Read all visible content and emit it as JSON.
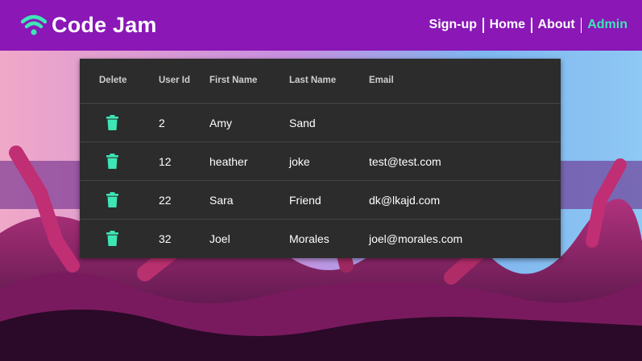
{
  "brand": {
    "name": "Code Jam",
    "icon": "wifi-icon",
    "icon_color": "#3ee6b6"
  },
  "nav": {
    "items": [
      {
        "label": "Sign-up",
        "active": false
      },
      {
        "label": "Home",
        "active": false
      },
      {
        "label": "About",
        "active": false
      },
      {
        "label": "Admin",
        "active": true
      }
    ],
    "bar_color": "#8a17b6",
    "active_color": "#3ee6b6"
  },
  "users_table": {
    "columns": [
      "Delete",
      "User Id",
      "First Name",
      "Last Name",
      "Email"
    ],
    "rows": [
      {
        "user_id": "2",
        "first_name": "Amy",
        "last_name": "Sand",
        "email": ""
      },
      {
        "user_id": "12",
        "first_name": "heather",
        "last_name": "joke",
        "email": "test@test.com"
      },
      {
        "user_id": "22",
        "first_name": "Sara",
        "last_name": "Friend",
        "email": "dk@lkajd.com"
      },
      {
        "user_id": "32",
        "first_name": "Joel",
        "last_name": "Morales",
        "email": "joel@morales.com"
      }
    ],
    "delete_icon": "trash-icon",
    "delete_icon_color": "#3ee6b6"
  }
}
